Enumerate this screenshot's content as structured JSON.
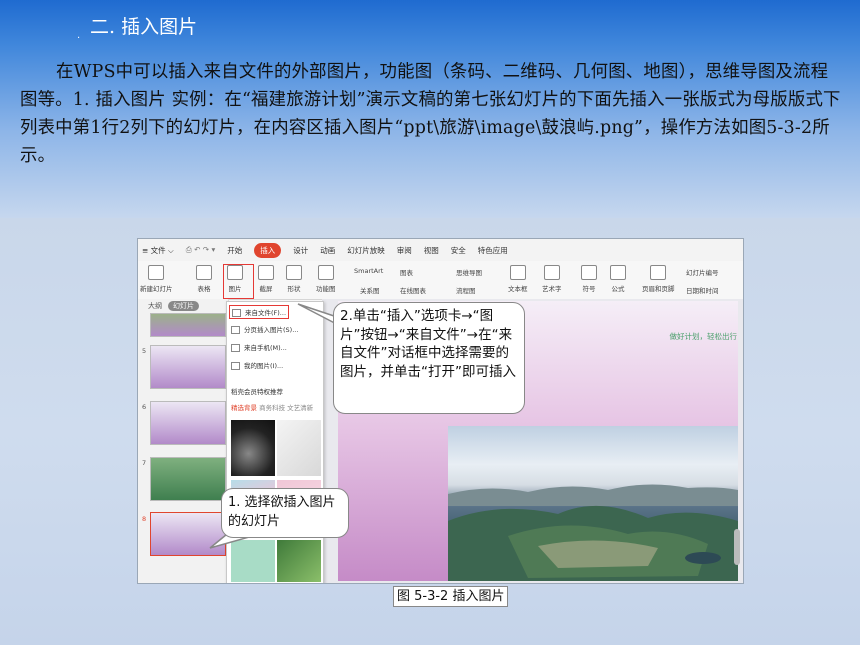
{
  "heading": "二. 插入图片",
  "paragraph": "在WPS中可以插入来自文件的外部图片，功能图（条码、二维码、几何图、地图），思维导图及流程图等。1. 插入图片    实例：在“福建旅游计划”演示文稿的第七张幻灯片的下面先插入一张版式为母版版式下列表中第1行2列下的幻灯片，在内容区插入图片“ppt\\旅游\\image\\鼓浪屿.png”，操作方法如图5-3-2所示。",
  "screenshot": {
    "menubar": [
      "≡ 文件 ⌵",
      "开始",
      "插入",
      "设计",
      "动画",
      "幻灯片放映",
      "审阅",
      "视图",
      "安全",
      "特色应用"
    ],
    "active_tab": "插入",
    "ribbon": {
      "new_slide": "新建幻灯片",
      "table": "表格",
      "picture": "图片",
      "screenshot": "截屏",
      "shape": "形状",
      "function_chart": "功能图",
      "smartart": "SmartArt",
      "chart": "图表",
      "relation": "关系图",
      "online_chart": "在线图表",
      "mindmap": "思维导图",
      "flowchart": "流程图",
      "textbox": "文本框",
      "art_text": "艺术字",
      "symbol": "符号",
      "formula": "公式",
      "header_footer": "页眉和页脚",
      "slide_number": "幻灯片编号",
      "date_time": "日期和时间"
    },
    "sidebar_tabs": [
      "大纲",
      "幻灯片"
    ],
    "slide_numbers": [
      "5",
      "6",
      "7",
      "8"
    ],
    "picture_menu": {
      "from_file": "来自文件(F)...",
      "batch_insert": "分页插入图片(S)...",
      "from_phone": "来自手机(M)...",
      "my_pictures": "我的图片(I)...",
      "recommend": "稻壳会员特权推荐",
      "categories": [
        "精选背景",
        "商务科技",
        "文艺清新"
      ]
    },
    "slogan": "做好计划，轻松出行"
  },
  "callout_2": "2.单击“插入”选项卡→“图片”按钮→“来自文件”→在“来自文件”对话框中选择需要的图片，并单击“打开”即可插入",
  "callout_1": "1. 选择欲插入图片的幻灯片",
  "caption": "图 5-3-2 插入图片",
  "colors": {
    "accent_red": "#e53935",
    "title_blue": "#1f6bd0",
    "slogan_green": "#4aa06b"
  }
}
